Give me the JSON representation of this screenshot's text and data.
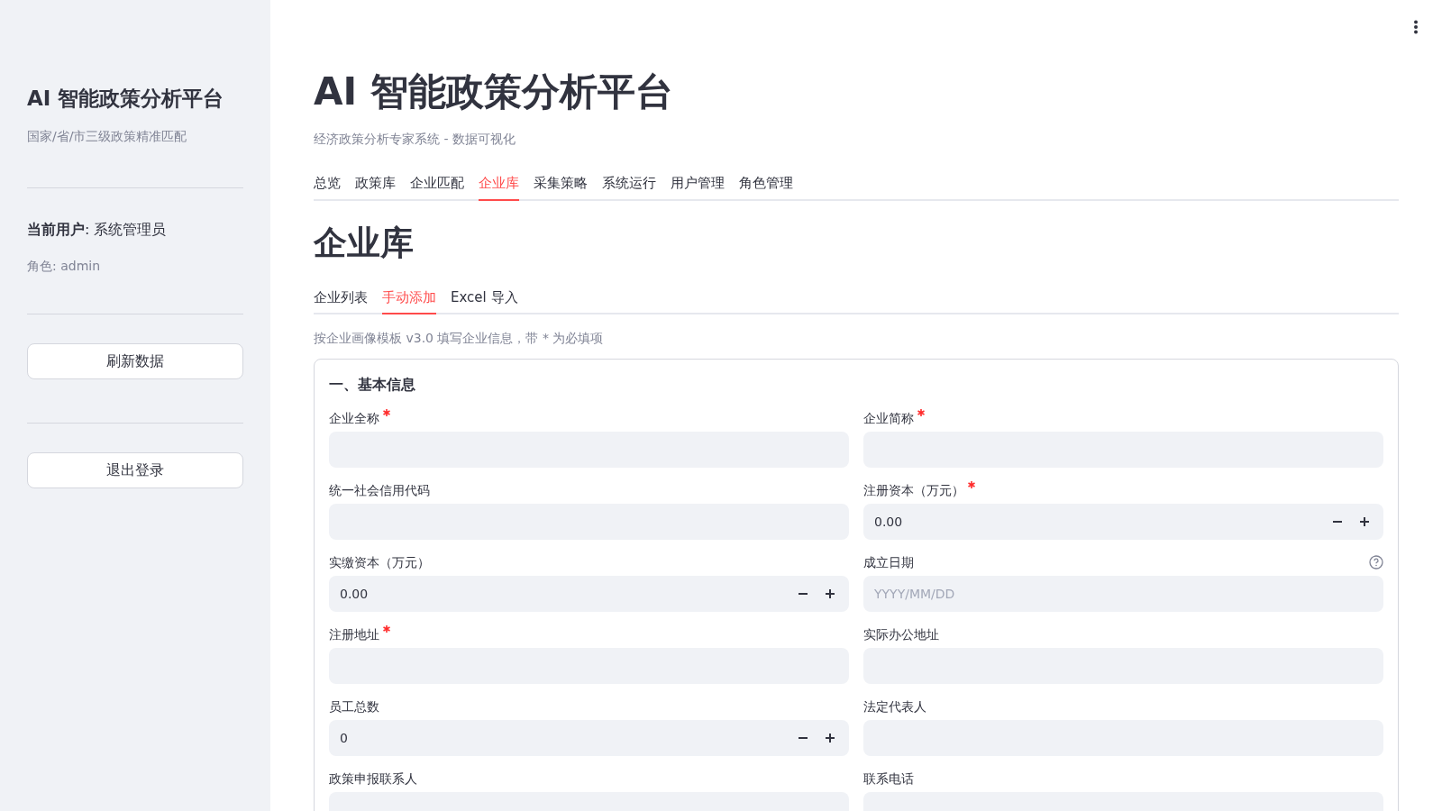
{
  "sidebar": {
    "title": "AI 智能政策分析平台",
    "subtitle": "国家/省/市三级政策精准匹配",
    "current_user": "**当前用户**: 系统管理员",
    "role": "角色: admin",
    "buttons": [
      "刷新数据",
      "退出登录"
    ]
  },
  "header": {
    "title": "AI 智能政策分析平台",
    "subtitle": "经济政策分析专家系统 - 数据可视化"
  },
  "tabs": [
    {
      "label": "总览",
      "selected": false
    },
    {
      "label": "政策库",
      "selected": false
    },
    {
      "label": "企业匹配",
      "selected": false
    },
    {
      "label": "企业库",
      "selected": true
    },
    {
      "label": "采集策略",
      "selected": false
    },
    {
      "label": "系统运行",
      "selected": false
    },
    {
      "label": "用户管理",
      "selected": false
    },
    {
      "label": "角色管理",
      "selected": false
    }
  ],
  "page_title": "企业库",
  "subtabs": [
    {
      "label": "企业列表",
      "selected": false
    },
    {
      "label": "手动添加",
      "selected": true
    },
    {
      "label": "Excel 导入",
      "selected": false
    }
  ],
  "caption": "按企业画像模板 v3.0 填写企业信息，带 * 为必填项",
  "form": {
    "section": "一、基本信息",
    "fields": [
      {
        "label": "企业全称",
        "kind": "text",
        "required": true
      },
      {
        "label": "企业简称",
        "kind": "text",
        "required": true
      },
      {
        "label": "统一社会信用代码",
        "kind": "text",
        "required": false
      },
      {
        "label": "注册资本（万元）",
        "kind": "number",
        "required": true,
        "value": "0.00"
      },
      {
        "label": "实缴资本（万元）",
        "kind": "number",
        "required": false,
        "value": "0.00"
      },
      {
        "label": "成立日期",
        "kind": "date",
        "required": false,
        "placeholder": "YYYY/MM/DD",
        "help": true
      },
      {
        "label": "注册地址",
        "kind": "text",
        "required": true
      },
      {
        "label": "实际办公地址",
        "kind": "text",
        "required": false
      },
      {
        "label": "员工总数",
        "kind": "number",
        "required": false,
        "value": "0"
      },
      {
        "label": "法定代表人",
        "kind": "text",
        "required": false
      },
      {
        "label": "政策申报联系人",
        "kind": "text",
        "required": false
      },
      {
        "label": "联系电话",
        "kind": "text",
        "required": false
      }
    ]
  }
}
